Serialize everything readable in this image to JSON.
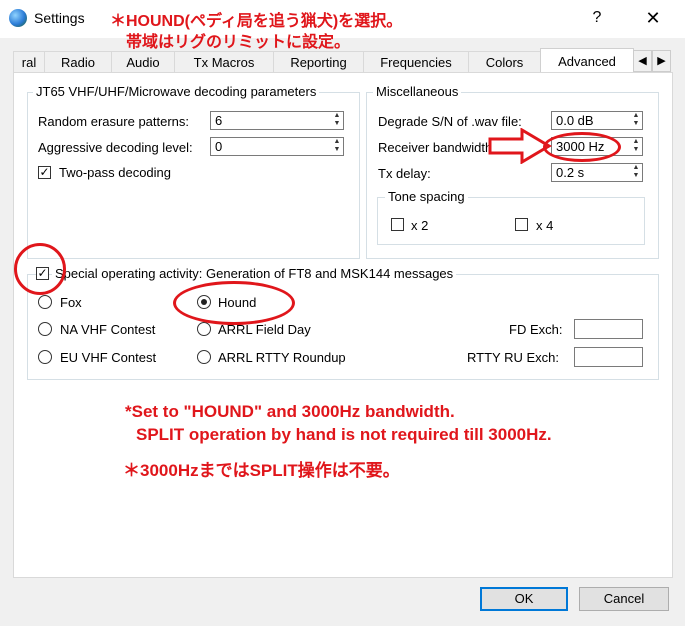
{
  "window": {
    "title": "Settings",
    "help": "?",
    "close": "✕"
  },
  "annotations": {
    "jp_title_line1": "＊HOUND(ペディ局を追う猟犬)を選択。",
    "jp_title_line2": "帯域はリグのリミットに設定。",
    "en_line1": "*Set to \"HOUND\" and 3000Hz bandwidth.",
    "en_line2": "SPLIT operation by hand is not required till 3000Hz.",
    "jp_bottom": "＊3000HzまではSPLIT操作は不要。",
    "color": "#e0161b"
  },
  "tabs": [
    {
      "label": "ral"
    },
    {
      "label": "Radio"
    },
    {
      "label": "Audio"
    },
    {
      "label": "Tx Macros"
    },
    {
      "label": "Reporting"
    },
    {
      "label": "Frequencies"
    },
    {
      "label": "Colors"
    },
    {
      "label": "Advanced",
      "active": true
    }
  ],
  "tab_scroll": {
    "left": "◀",
    "right": "▶"
  },
  "jt65": {
    "title": "JT65 VHF/UHF/Microwave decoding parameters",
    "random_erasure_label": "Random erasure patterns:",
    "random_erasure_value": "6",
    "aggressive_label": "Aggressive decoding level:",
    "aggressive_value": "0",
    "two_pass_label": "Two-pass decoding",
    "two_pass_checked": "✓"
  },
  "misc": {
    "title": "Miscellaneous",
    "degrade_label": "Degrade S/N of .wav file:",
    "degrade_value": "0.0 dB",
    "rx_bw_label": "Receiver bandwidth:",
    "rx_bw_value": "3000  Hz",
    "tx_delay_label": "Tx delay:",
    "tx_delay_value": "0.2  s",
    "tone_spacing_title": "Tone spacing",
    "x2_label": "x 2",
    "x4_label": "x 4"
  },
  "special": {
    "checked": "✓",
    "title": "Special operating activity: Generation of FT8 and MSK144 messages",
    "fox": "Fox",
    "hound": "Hound",
    "na_vhf": "NA VHF Contest",
    "arrl_field_day": "ARRL Field Day",
    "eu_vhf": "EU VHF Contest",
    "arrl_rtty": "ARRL RTTY Roundup",
    "fd_exch_label": "FD Exch:",
    "fd_exch_value": "",
    "rtty_exch_label": "RTTY RU Exch:",
    "rtty_exch_value": "",
    "selected": "Hound"
  },
  "buttons": {
    "ok": "OK",
    "cancel": "Cancel"
  },
  "spin_arrows": {
    "up": "▲",
    "down": "▼"
  }
}
